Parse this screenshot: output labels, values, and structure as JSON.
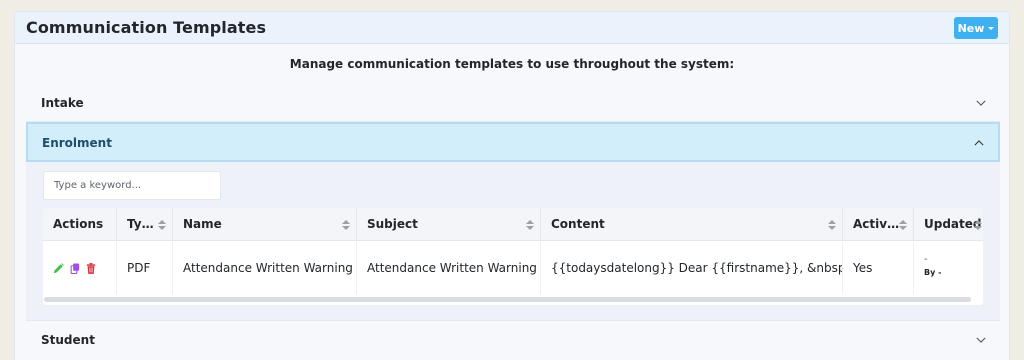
{
  "header": {
    "title": "Communication Templates",
    "new_button": "New"
  },
  "subtitle": "Manage communication templates to use throughout the system:",
  "sections": [
    {
      "label": "Intake",
      "expanded": false
    },
    {
      "label": "Enrolment",
      "expanded": true
    },
    {
      "label": "Student",
      "expanded": false
    }
  ],
  "search": {
    "placeholder": "Type a keyword..."
  },
  "table": {
    "columns": [
      "Actions",
      "Ty…",
      "Name",
      "Subject",
      "Content",
      "Activ…",
      "Updated"
    ],
    "rows": [
      {
        "type": "PDF",
        "name": "Attendance Written Warning",
        "subject": "Attendance Written Warning",
        "content": "{{todaysdatelong}} Dear {{firstname}}, &nbsp; …",
        "active": "Yes",
        "updated": "-",
        "updated_by": "By -"
      }
    ]
  },
  "icons": {
    "edit": "pencil-icon",
    "copy": "copy-icon",
    "delete": "trash-icon"
  },
  "colors": {
    "accent": "#3fb1ee",
    "active_section": "#d3eefb",
    "edit": "#3fbf4a",
    "copy": "#a54ee0",
    "delete": "#d9303b"
  }
}
